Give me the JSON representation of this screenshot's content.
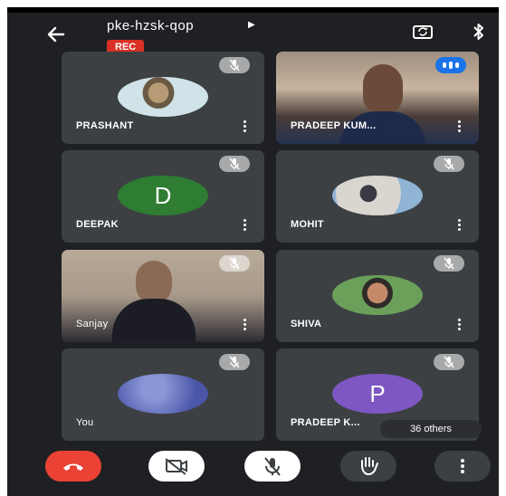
{
  "header": {
    "meeting_code": "pke-hzsk-qop",
    "rec_label": "REC"
  },
  "tiles": [
    {
      "name": "PRASHANT"
    },
    {
      "name": "PRADEEP KUM..."
    },
    {
      "name": "DEEPAK",
      "avatar_letter": "D",
      "avatar_color": "#2e7d32"
    },
    {
      "name": "MOHIT"
    },
    {
      "name": "Sanjay"
    },
    {
      "name": "SHIVA"
    },
    {
      "name": "You"
    },
    {
      "name": "PRADEEP K...",
      "avatar_letter": "P",
      "avatar_color": "#7e57c2"
    }
  ],
  "others_label": "36 others",
  "colors": {
    "background": "#1f2023",
    "tile": "#3c4043",
    "rec": "#d93025",
    "end_call": "#ea4335",
    "speaking": "#1a73e8"
  },
  "icons": [
    "back-arrow-icon",
    "switch-camera-icon",
    "bluetooth-icon",
    "mic-off-icon",
    "more-vert-icon",
    "end-call-icon",
    "camera-off-icon",
    "raise-hand-icon",
    "speaking-indicator-icon"
  ]
}
